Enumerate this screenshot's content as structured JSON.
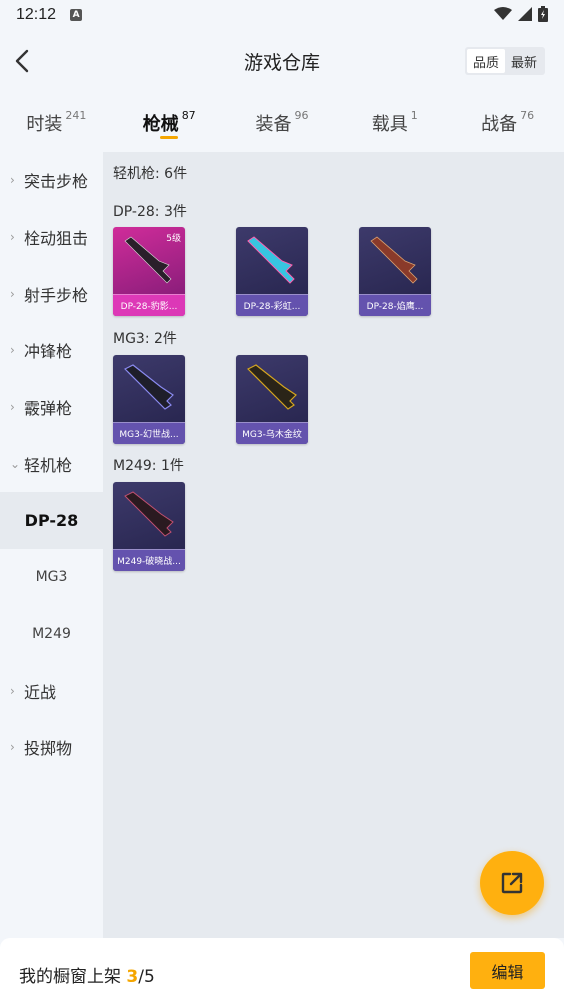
{
  "status_bar": {
    "time": "12:12",
    "badge": "A"
  },
  "header": {
    "title": "游戏仓库",
    "sort_options": [
      "品质",
      "最新"
    ],
    "active_sort": 0
  },
  "tabs": [
    {
      "label": "时装",
      "count": "241"
    },
    {
      "label": "枪械",
      "count": "87",
      "active": true
    },
    {
      "label": "装备",
      "count": "96"
    },
    {
      "label": "载具",
      "count": "1"
    },
    {
      "label": "战备",
      "count": "76"
    }
  ],
  "sidebar": {
    "items": [
      {
        "label": "突击步枪",
        "expanded": false
      },
      {
        "label": "栓动狙击",
        "expanded": false
      },
      {
        "label": "射手步枪",
        "expanded": false
      },
      {
        "label": "冲锋枪",
        "expanded": false
      },
      {
        "label": "霰弹枪",
        "expanded": false
      },
      {
        "label": "轻机枪",
        "expanded": true
      }
    ],
    "sub_items": [
      {
        "label": "DP-28",
        "active": true
      },
      {
        "label": "MG3"
      },
      {
        "label": "M249"
      }
    ],
    "items_after": [
      {
        "label": "近战"
      },
      {
        "label": "投掷物"
      }
    ]
  },
  "content": {
    "summary": "轻机枪: 6件",
    "groups": [
      {
        "title": "DP-28: 3件",
        "cards": [
          {
            "label": "DP-28-豹影...",
            "level": "5级",
            "style": "pink",
            "gun": "#2a1f2a"
          },
          {
            "label": "DP-28-彩虹...",
            "style": "dark",
            "gun": "#37c6e0"
          },
          {
            "label": "DP-28-焰鹰...",
            "style": "dark",
            "gun": "#8a3a2a"
          }
        ]
      },
      {
        "title": "MG3: 2件",
        "cards": [
          {
            "label": "MG3-幻世战...",
            "style": "dark",
            "gun": "#6a6ad8"
          },
          {
            "label": "MG3-乌木金纹",
            "style": "dark",
            "gun": "#d4a520"
          }
        ]
      },
      {
        "title": "M249: 1件",
        "cards": [
          {
            "label": "M249-破晓战...",
            "style": "dark",
            "gun": "#7a3040"
          }
        ]
      }
    ]
  },
  "bottom": {
    "shelf_label": "我的橱窗上架",
    "current": "3",
    "total": "/5",
    "edit_label": "编辑"
  },
  "colors": {
    "accent": "#ffb00f",
    "highlight": "#f5a600"
  }
}
